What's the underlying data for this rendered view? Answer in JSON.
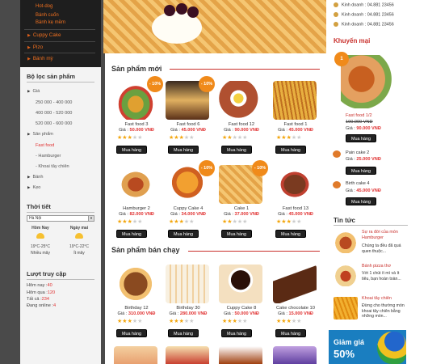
{
  "menu": {
    "sub_items": [
      "Hot-dog",
      "Bánh cuốn",
      "Bánh kẹ mềm"
    ],
    "items": [
      "Cuppy Cake",
      "Pizo",
      "Bánh mỳ"
    ]
  },
  "filter": {
    "title": "Bộ lọc sản phẩm",
    "price_label": "Giá",
    "price_ranges": [
      "250 000 - 400 000",
      "400 000 - 520 000",
      "520 000 - 600 000"
    ],
    "category_label": "Sản phẩm",
    "categories": [
      "Fast food",
      "Hamburger",
      "Khoai tây chiên"
    ],
    "other1": "Bánh",
    "other2": "Kẹo"
  },
  "weather": {
    "title": "Thời tiết",
    "city": "Hà Nội",
    "today_label": "Hôm Nay",
    "tomorrow_label": "Ngày mai",
    "today_temp": "19°C-25°C",
    "tomorrow_temp": "19°C-22°C",
    "today_desc": "Nhiều mây",
    "tomorrow_desc": "Ít mây"
  },
  "stats": {
    "title": "Lượt truy cập",
    "today_label": "Hôm nay :",
    "today_val": "40",
    "yesterday_label": "Hôm qua :",
    "yesterday_val": "120",
    "total_label": "Tất cả :",
    "total_val": "234",
    "online_label": "Đang online :",
    "online_val": "4"
  },
  "contact": {
    "lines": [
      "Kinh doanh : 04.881 23456",
      "Kinh doanh : 04.881 23456",
      "Kinh doanh : 04.881 23456"
    ]
  },
  "sections": {
    "new_title": "Sản phẩm mới",
    "best_title": "Sản phẩm bán chạy"
  },
  "buy_label": "Mua hàng",
  "price_prefix": "Giá :",
  "products_new": [
    {
      "name": "Fast food 3",
      "price": "50.000 VNĐ",
      "badge": "- 10%",
      "rating": 3
    },
    {
      "name": "Fast food 6",
      "price": "45.000 VNĐ",
      "badge": "- 10%",
      "rating": 3
    },
    {
      "name": "Fast food 12",
      "price": "90.000 VNĐ",
      "badge": "",
      "rating": 2
    },
    {
      "name": "Fast food 1",
      "price": "45.000 VNĐ",
      "badge": "",
      "rating": 3
    },
    {
      "name": "Hamburger 2",
      "price": "82.000 VNĐ",
      "badge": "",
      "rating": 3
    },
    {
      "name": "Cuppy Cake 4",
      "price": "34.000 VNĐ",
      "badge": "- 10%",
      "rating": 3
    },
    {
      "name": "Cake 1",
      "price": "37.000 VNĐ",
      "badge": "- 10%",
      "rating": 2
    },
    {
      "name": "Fast food 13",
      "price": "45.000 VNĐ",
      "badge": "",
      "rating": 3
    }
  ],
  "products_best": [
    {
      "name": "Birthday 12",
      "price": "310.000 VNĐ",
      "rating": 3
    },
    {
      "name": "Birthday 30",
      "price": "280.000 VNĐ",
      "rating": 3
    },
    {
      "name": "Cuppy Cake 8",
      "price": "50.000 VNĐ",
      "rating": 3
    },
    {
      "name": "Cake chocolate 10",
      "price": "15.000 VNĐ",
      "rating": 3
    }
  ],
  "right": {
    "promo_title": "Khuyến mại",
    "promo_badge": "1",
    "promo_name": "Fast food 1/2",
    "promo_old": "100.000 VNĐ",
    "promo_price": "90.000 VNĐ",
    "item2_name": "Pain cake 2",
    "item2_price": "25.000 VNĐ",
    "item3_name": "Birth cake 4",
    "item3_price": "45.000 VNĐ",
    "news_title": "Tin tức",
    "news": [
      {
        "title": "Sự ra đời của món Hamburger",
        "desc": "Chúng ta đều đã quá quen thuộc..."
      },
      {
        "title": "Bánh pizza thơ",
        "desc": "Với 1 chút ít mì và ít tiêu, bạn hoàn toàn..."
      },
      {
        "title": "Khoai tây chiên",
        "desc": "Đừng cho thường món khoai tây chiên bằng những món..."
      }
    ],
    "sale_line1": "Giảm giá",
    "sale_line2": "50%"
  }
}
